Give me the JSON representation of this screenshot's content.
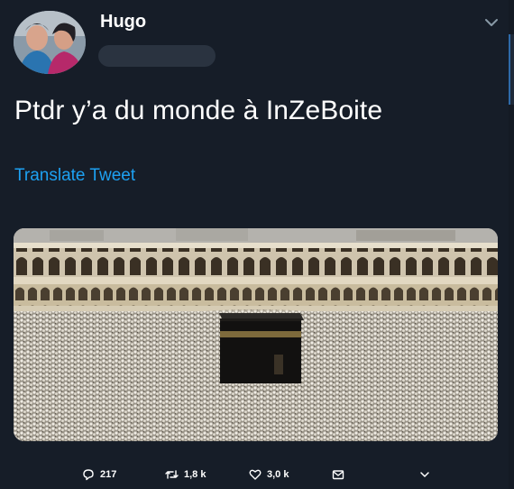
{
  "header": {
    "display_name": "Hugo"
  },
  "tweet": {
    "text": "Ptdr y’a du monde à InZeBoite",
    "translate_label": "Translate Tweet"
  },
  "actions": {
    "replies": "217",
    "retweets": "1,8 k",
    "likes": "3,0 k"
  },
  "icons": {
    "menu": "chevron-down-icon",
    "reply": "reply-icon",
    "retweet": "retweet-icon",
    "like": "heart-icon",
    "message": "envelope-icon",
    "more": "chevron-down-icon"
  },
  "colors": {
    "background": "#161d28",
    "link": "#1da1f2",
    "text": "#ffffff"
  }
}
